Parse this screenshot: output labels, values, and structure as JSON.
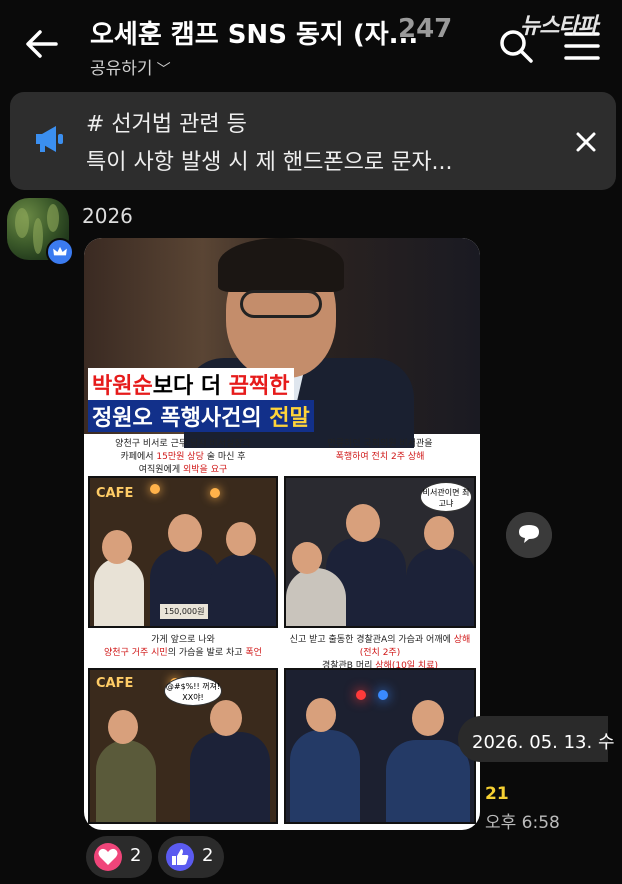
{
  "header": {
    "title": "오세훈 캠프 SNS 동지 (자...",
    "member_count": "247",
    "share_label": "공유하기",
    "watermark": "뉴스타파"
  },
  "notice": {
    "line1": "# 선거법 관련 등",
    "line2": "특이 사항 발생 시 제 핸드폰으로 문자..."
  },
  "message": {
    "sender": "2026",
    "image": {
      "headline_line1_a": "박원순",
      "headline_line1_b": "보다 더 ",
      "headline_line1_c": "끔찍한",
      "headline_line2_a": "정원오 폭행사건의 ",
      "headline_line2_b": "전말",
      "panel1_caption_a": "양천구 비서로 근무 당시 비서실장과",
      "panel1_caption_b": "카페에서 ",
      "panel1_caption_b_red": "15만원 상당",
      "panel1_caption_b_end": " 술 마신 후",
      "panel1_caption_c": "여직원에게 ",
      "panel1_caption_c_red": "외박을 요구",
      "panel2_caption_a": "만류하던 국회의원 비서관을",
      "panel2_caption_b": "폭행하여 전치 2주 상해",
      "panel3_caption_a": "가게 앞으로 나와",
      "panel3_caption_b_red": "양천구 거주 시민",
      "panel3_caption_b": "의 가슴을 발로 차고 ",
      "panel3_caption_b_red2": "폭언",
      "panel4_caption_a": "신고 받고 출동한 경찰관A의 가슴과 어깨에 ",
      "panel4_caption_a_red": "상해(전치 2주)",
      "panel4_caption_b": "경찰관B 머리 ",
      "panel4_caption_b_red": "상해(10일 치료)",
      "cafe_sign": "CAFE",
      "price_tag": "150,000원",
      "bubble_panel2": "비서관이면 최고냐",
      "bubble_panel3": "@#$%!! 꺼져! XX야!"
    },
    "date_label": "2026. 05. 13. 수",
    "unread_count": "21",
    "time": "오후 6:58"
  },
  "reactions": [
    {
      "icon": "heart-icon",
      "count": "2",
      "color": "#f0457a"
    },
    {
      "icon": "thumbs-up-icon",
      "count": "2",
      "color": "#5b5bf0"
    }
  ]
}
